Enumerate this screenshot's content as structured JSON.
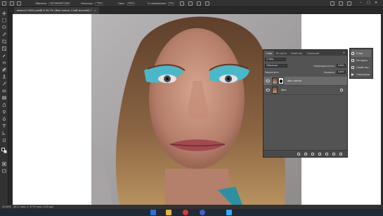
{
  "options_bar": {
    "layer_label": "Образец:",
    "layer_value": "Активный слой",
    "mode_label": "Непрозр.:",
    "mode_value": "75%",
    "opacity_label": "Наж.:",
    "opacity_value": "40%",
    "smoothing_label": "Сглаживание:",
    "smoothing_value": "0%",
    "winbtns": [
      "–",
      "□",
      "✕"
    ]
  },
  "document_tab": {
    "title": "вмолот11801.psd@ 8 45,7% (Фон копия, Слой-маска/8) *",
    "close": "×"
  },
  "status_bar": {
    "zoom": "45,68%",
    "info": "4017 пикс × 4774 пикс (300 ppi)"
  },
  "layers_panel": {
    "tabs": [
      "Слои",
      "История",
      "Свойства",
      "Операции"
    ],
    "menu_icon": "≡",
    "filter_label": "Q Вид",
    "blend_mode": "Обычные",
    "opacity_label": "Непрозрачность:",
    "opacity_value": "100%",
    "lock_label": "Закрепить:",
    "fill_label": "Заливка:",
    "fill_value": "100%",
    "layers": [
      {
        "name": "Фон копия",
        "selected": true,
        "has_mask": true
      },
      {
        "name": "Фон",
        "selected": false,
        "has_mask": false
      }
    ]
  },
  "panel_column": {
    "items": [
      {
        "label": "Слои",
        "icon": "layers-icon",
        "active": true
      },
      {
        "label": "История",
        "icon": "history-icon",
        "active": false
      },
      {
        "label": "Свойства",
        "icon": "properties-icon",
        "active": false
      },
      {
        "label": "Операции",
        "icon": "actions-icon",
        "active": false
      }
    ]
  },
  "colors": {
    "foreground": "#000000",
    "background": "#ffffff",
    "ui_dark": "#323232",
    "panel": "#535353",
    "eyeshadow": "#4ab8c8"
  }
}
